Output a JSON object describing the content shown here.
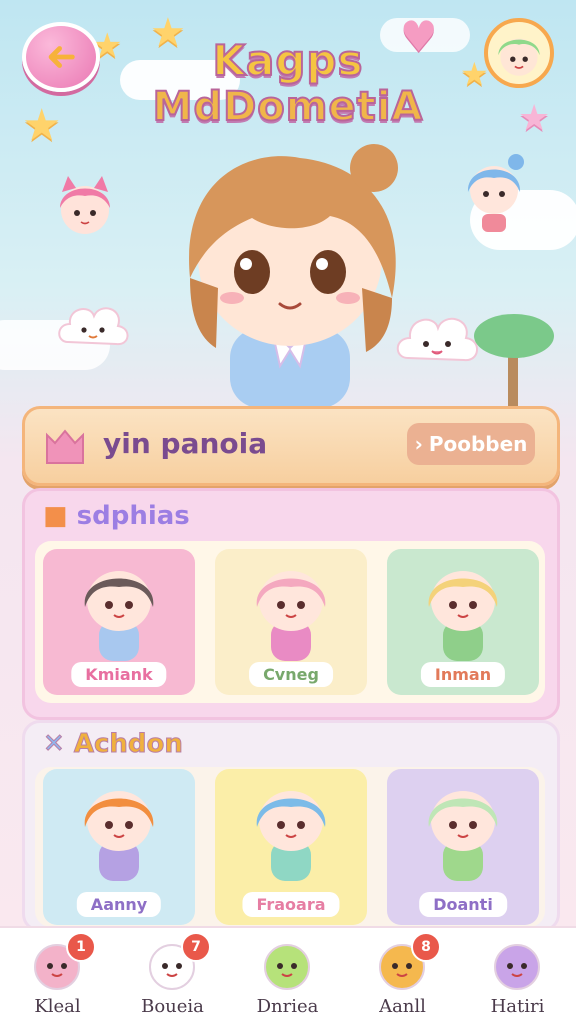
{
  "header": {
    "title_line1": "Kagps",
    "title_line2": "MdDometiA",
    "back_icon": "arrow-left-icon"
  },
  "profile": {
    "name": "yin panoia",
    "action_label": "Poobben"
  },
  "sections": [
    {
      "title": "sdphias",
      "cards": [
        {
          "label": "Kmiank",
          "bg": "#f7b9d2",
          "hair": "#6b5a5a",
          "dress": "#a8c8ef",
          "label_color": "#e86fa0"
        },
        {
          "label": "Cvneg",
          "bg": "#fbeec9",
          "hair": "#f4a8bf",
          "dress": "#e98bc4",
          "label_color": "#78a86c"
        },
        {
          "label": "Inman",
          "bg": "#c9e8cf",
          "hair": "#f4d27a",
          "dress": "#8fcf8a",
          "label_color": "#e27a5a"
        }
      ]
    },
    {
      "title": "Achdon",
      "cards": [
        {
          "label": "Aanny",
          "bg": "#cfeaf3",
          "hair": "#f28e3f",
          "dress": "#b5a1e3",
          "label_color": "#8e6fc6"
        },
        {
          "label": "Fraoara",
          "bg": "#fbeea8",
          "hair": "#7cbbe8",
          "dress": "#8fd7c4",
          "label_color": "#e67ea3"
        },
        {
          "label": "Doanti",
          "bg": "#ddd0f0",
          "hair": "#bfe6b6",
          "dress": "#9fd88c",
          "label_color": "#8e6fc6"
        }
      ]
    }
  ],
  "nav": [
    {
      "label": "Kleal",
      "badge": "1",
      "icon": "girl-avatar-icon"
    },
    {
      "label": "Boueia",
      "badge": "7",
      "icon": "cloud-face-icon"
    },
    {
      "label": "Dnriea",
      "badge": "",
      "icon": "green-frog-icon"
    },
    {
      "label": "Aanll",
      "badge": "8",
      "icon": "blonde-girl-icon"
    },
    {
      "label": "Hatiri",
      "badge": "",
      "icon": "magic-mirror-icon"
    }
  ]
}
